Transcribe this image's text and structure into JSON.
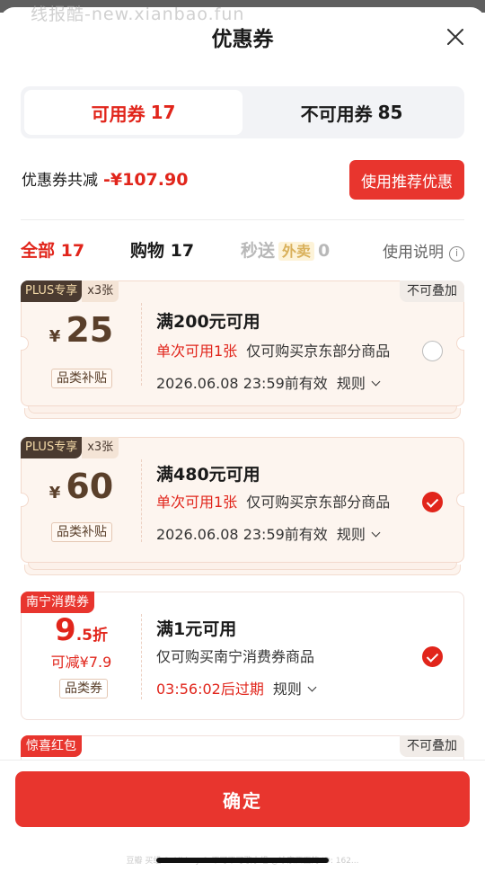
{
  "watermark": "线报酷-new.xianbao.fun",
  "header": {
    "title": "优惠券"
  },
  "segment": {
    "available_label": "可用券",
    "available_count": "17",
    "unavailable_label": "不可用券",
    "unavailable_count": "85"
  },
  "summary": {
    "label": "优惠券共减",
    "amount": "-¥107.90",
    "recommend_button": "使用推荐优惠"
  },
  "filters": {
    "all_label": "全部",
    "all_count": "17",
    "shopping_label": "购物",
    "shopping_count": "17",
    "flash_label": "秒送",
    "flash_badge": "外卖",
    "flash_count": "0",
    "help_label": "使用说明"
  },
  "coupons": [
    {
      "tag_a": "PLUS专享",
      "tag_b": "x3张",
      "no_stack": "不可叠加",
      "currency": "¥",
      "amount": "25",
      "category": "品类补贴",
      "condition": "满200元可用",
      "limit": "单次可用1张",
      "scope": "仅可购买京东部分商品",
      "expiry": "2026.06.08 23:59前有效",
      "rule": "规则",
      "selected": false
    },
    {
      "tag_a": "PLUS专享",
      "tag_b": "x3张",
      "currency": "¥",
      "amount": "60",
      "category": "品类补贴",
      "condition": "满480元可用",
      "limit": "单次可用1张",
      "scope": "仅可购买京东部分商品",
      "expiry": "2026.06.08 23:59前有效",
      "rule": "规则",
      "selected": true
    },
    {
      "tag": "南宁消费券",
      "discount_main": "9",
      "discount_sub": ".5折",
      "reduce": "可减¥7.9",
      "category": "品类券",
      "condition": "满1元可用",
      "scope": "仅可购买南宁消费券商品",
      "countdown": "03:56:02后过期",
      "rule": "规则",
      "selected": true
    },
    {
      "tag": "惊喜红包",
      "no_stack": "不可叠加"
    }
  ],
  "footer": {
    "confirm": "确定",
    "watermark": "豆瓣 买组 & All buy & 不可不可歌小组 @冰京西面的 ID: 162..."
  },
  "colors": {
    "accent": "#e1251b",
    "button": "#e8352e",
    "coupon_bg": "#fdf5ef",
    "price_brown": "#5a3f2a"
  }
}
